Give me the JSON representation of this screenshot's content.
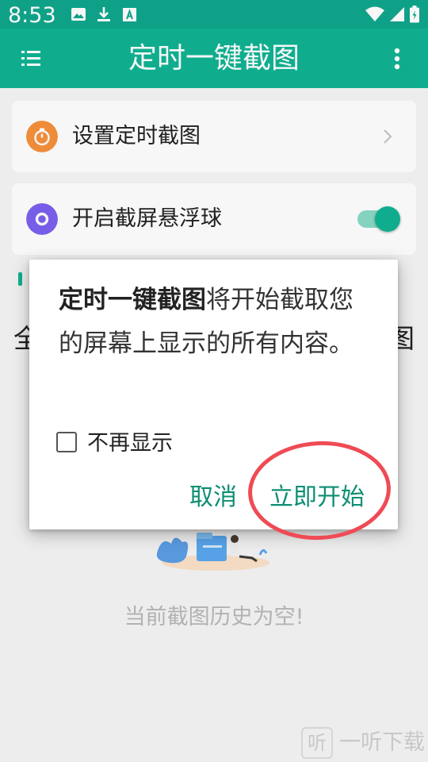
{
  "status_bar": {
    "time": "8:53",
    "left_icons": [
      "image-icon",
      "download-icon",
      "a-box-icon"
    ],
    "right_icons": [
      "wifi-icon",
      "signal-icon",
      "battery-icon"
    ]
  },
  "app_bar": {
    "title": "定时一键截图",
    "menu_icon": "list-menu-icon",
    "more_icon": "more-vertical-icon"
  },
  "settings": {
    "schedule": {
      "label": "设置定时截图",
      "icon": "timer-icon",
      "icon_color": "#f6913c"
    },
    "floating_ball": {
      "label": "开启截屏悬浮球",
      "icon": "ring-icon",
      "icon_color": "#7b61f0",
      "enabled": true
    }
  },
  "background": {
    "left_char": "全",
    "right_char": "图",
    "empty_history": "当前截图历史为空!"
  },
  "dialog": {
    "message_bold": "定时一键截图",
    "message_rest": "将开始截取您的屏幕上显示的所有内容。",
    "dont_show_again": "不再显示",
    "dont_show_checked": false,
    "cancel": "取消",
    "start_now": "立即开始"
  },
  "watermark": {
    "badge": "听",
    "text": "一听下载"
  },
  "colors": {
    "primary": "#10b393",
    "status_bar": "#10a78d",
    "button_text": "#0c8e73",
    "highlight_ring": "#ef4b55"
  }
}
